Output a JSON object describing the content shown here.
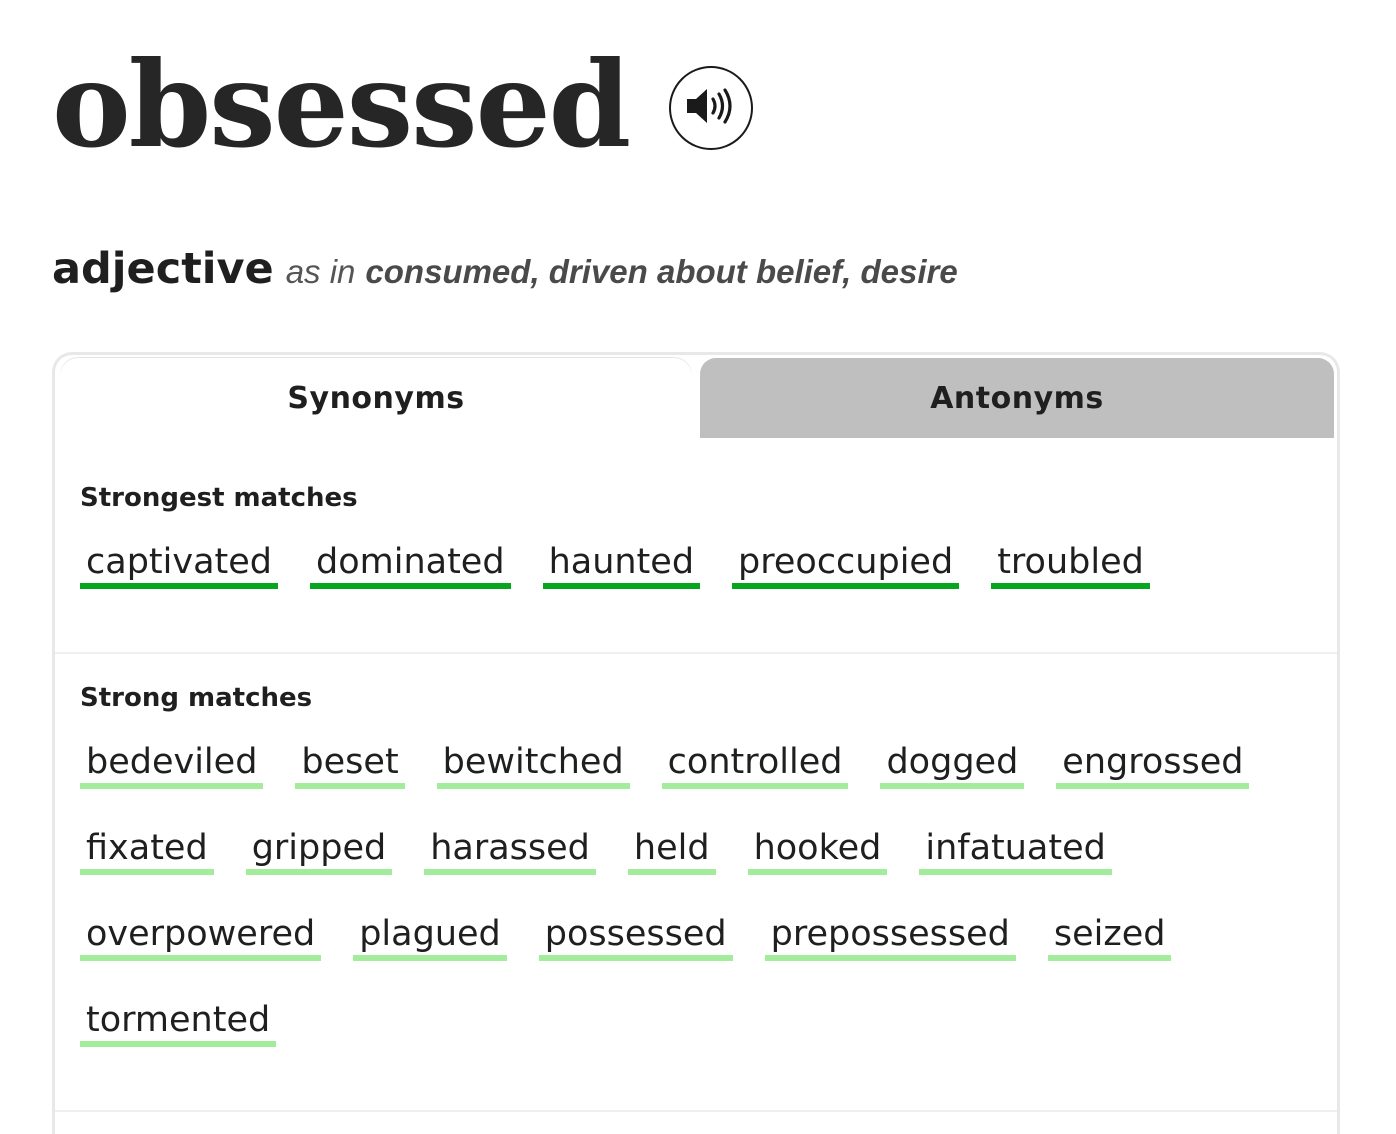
{
  "entry": {
    "word": "obsessed",
    "part_of_speech": "adjective",
    "as_in_label": "as in",
    "sense": "consumed, driven about belief, desire"
  },
  "tabs": {
    "synonyms_label": "Synonyms",
    "antonyms_label": "Antonyms",
    "active": "Synonyms"
  },
  "colors": {
    "strongest_underline": "#05a61e",
    "strong_underline": "#a2ec9b",
    "inactive_tab_bg": "#bfbfbf"
  },
  "icons": {
    "audio": "speaker-volume-icon"
  },
  "strongest": {
    "title": "Strongest matches",
    "words": [
      "captivated",
      "dominated",
      "haunted",
      "preoccupied",
      "troubled"
    ]
  },
  "strong": {
    "title": "Strong matches",
    "words": [
      "bedeviled",
      "beset",
      "bewitched",
      "controlled",
      "dogged",
      "engrossed",
      "fixated",
      "gripped",
      "harassed",
      "held",
      "hooked",
      "infatuated",
      "overpowered",
      "plagued",
      "possessed",
      "prepossessed",
      "seized",
      "tormented"
    ]
  }
}
